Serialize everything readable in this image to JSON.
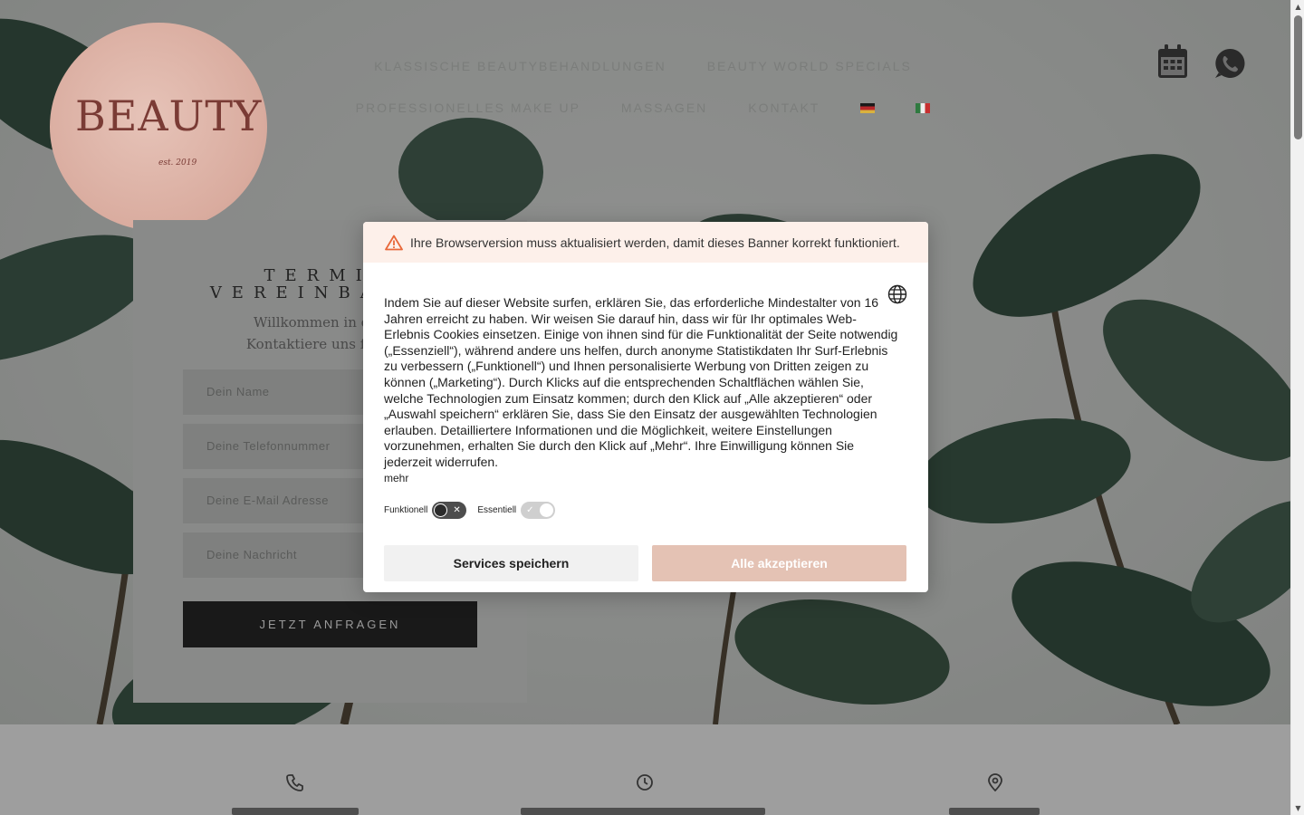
{
  "brand": {
    "logo_text": "BEAUTY",
    "logo_tagline": "est. 2019"
  },
  "nav": {
    "row1": [
      "KLASSISCHE BEAUTYBEHANDLUNGEN",
      "BEAUTY WORLD SPECIALS"
    ],
    "row2": [
      "PROFESSIONELLES MAKE UP",
      "MASSAGEN",
      "KONTAKT"
    ],
    "languages": [
      "de",
      "it"
    ]
  },
  "header_icons": [
    "calendar-icon",
    "whatsapp-icon"
  ],
  "form": {
    "title_line1": "TERMIN",
    "title_line2": "VEREINBAREN",
    "intro_line1": "Willkommen in der Be",
    "intro_line2": "Kontaktiere uns für eine",
    "name_placeholder": "Dein Name",
    "phone_placeholder": "Deine Telefonnummer",
    "email_placeholder": "Deine E-Mail Adresse",
    "message_placeholder": "Deine Nachricht",
    "submit_label": "JETZT ANFRAGEN"
  },
  "info_strip": {
    "icons": [
      "phone-icon",
      "clock-icon",
      "location-pin-icon"
    ]
  },
  "cookie_banner": {
    "warning": "Ihre Browserversion muss aktualisiert werden, damit dieses Banner korrekt funktioniert.",
    "text": "Indem Sie auf dieser Website surfen, erklären Sie, das erforderliche Mindestalter von 16 Jahren erreicht zu haben. Wir weisen Sie darauf hin, dass wir für Ihr optimales Web-Erlebnis Cookies einsetzen. Einige von ihnen sind für die Funktionalität der Seite notwendig („Essenziell“), während andere uns helfen, durch anonyme Statistikdaten Ihr Surf-Erlebnis zu verbessern („Funktionell“) und Ihnen personalisierte Werbung von Dritten zeigen zu können („Marketing“). Durch Klicks auf die entsprechenden Schaltflächen wählen Sie, welche Technologien zum Einsatz kommen; durch den Klick auf „Alle akzeptieren“ oder „Auswahl speichern“ erklären Sie, dass Sie den Einsatz der ausgewählten Technologien erlauben. Detailliertere Informationen und die Möglichkeit, weitere Einstellungen vorzunehmen, erhalten Sie durch den Klick auf „Mehr“. Ihre Einwilligung können Sie jederzeit widerrufen.",
    "more_label": "mehr",
    "toggle_functional_label": "Funktionell",
    "toggle_functional_on": false,
    "toggle_essential_label": "Essentiell",
    "toggle_essential_on": true,
    "save_button": "Services speichern",
    "accept_button": "Alle akzeptieren",
    "accent_color": "#e4c2b4"
  }
}
